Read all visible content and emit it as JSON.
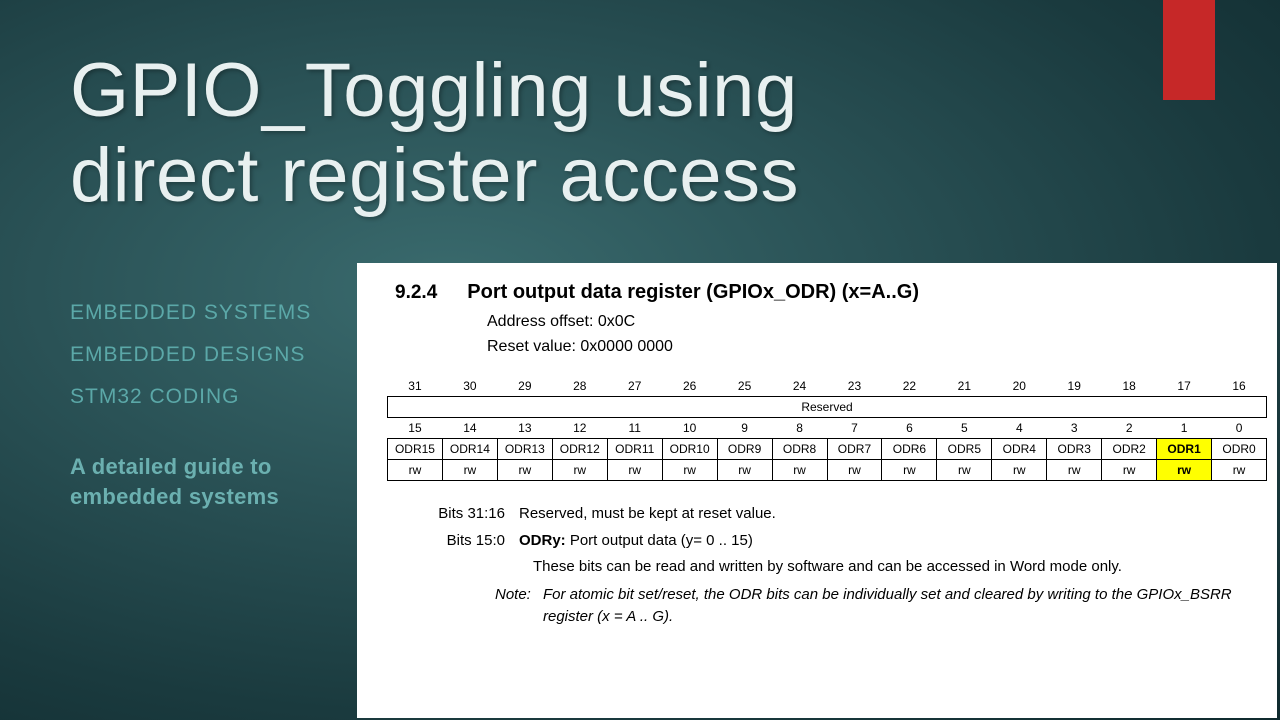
{
  "accent_color": "#c62828",
  "title_line1": "GPIO_Toggling using",
  "title_line2": "direct register access",
  "tags": {
    "t1": "EMBEDDED SYSTEMS",
    "t2": "EMBEDDED DESIGNS",
    "t3": "STM32 CODING"
  },
  "subtitle_line1": "A detailed guide to",
  "subtitle_line2": "embedded systems",
  "doc": {
    "section_num": "9.2.4",
    "section_title": "Port output data register (GPIOx_ODR) (x=A..G)",
    "address_offset_label": "Address offset: 0x0C",
    "reset_value_label": "Reset value: 0x0000 0000",
    "bits_high": [
      "31",
      "30",
      "29",
      "28",
      "27",
      "26",
      "25",
      "24",
      "23",
      "22",
      "21",
      "20",
      "19",
      "18",
      "17",
      "16"
    ],
    "reserved_label": "Reserved",
    "bits_low": [
      "15",
      "14",
      "13",
      "12",
      "11",
      "10",
      "9",
      "8",
      "7",
      "6",
      "5",
      "4",
      "3",
      "2",
      "1",
      "0"
    ],
    "odr_row": [
      "ODR15",
      "ODR14",
      "ODR13",
      "ODR12",
      "ODR11",
      "ODR10",
      "ODR9",
      "ODR8",
      "ODR7",
      "ODR6",
      "ODR5",
      "ODR4",
      "ODR3",
      "ODR2",
      "ODR1",
      "ODR0"
    ],
    "rw_row": [
      "rw",
      "rw",
      "rw",
      "rw",
      "rw",
      "rw",
      "rw",
      "rw",
      "rw",
      "rw",
      "rw",
      "rw",
      "rw",
      "rw",
      "rw",
      "rw"
    ],
    "highlight_index": 14,
    "desc_bits_31_16_label": "Bits 31:16",
    "desc_bits_31_16_text": "Reserved, must be kept at reset value.",
    "desc_bits_15_0_label": "Bits 15:0",
    "desc_bits_15_0_bold": "ODRy:",
    "desc_bits_15_0_text": " Port output data (y= 0 .. 15)",
    "desc_bits_15_0_sub": "These bits can be read and written by software and can be accessed in Word mode only.",
    "note_label": "Note:",
    "note_text": "For atomic bit set/reset, the ODR bits can be individually set and cleared by writing to the GPIOx_BSRR register (x = A .. G)."
  }
}
